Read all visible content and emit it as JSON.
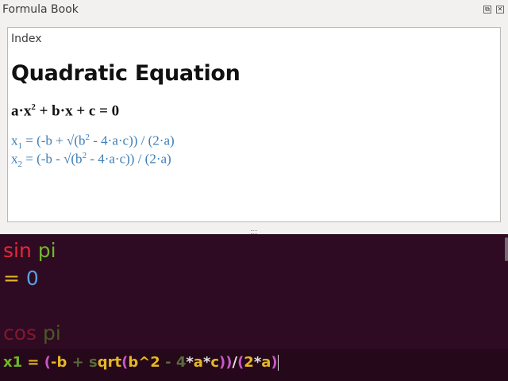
{
  "window": {
    "title": "Formula Book",
    "float_icon": "⧉",
    "close_icon": "✕"
  },
  "formula_panel": {
    "index_link": "Index",
    "heading": "Quadratic Equation",
    "equation": {
      "a": "a·x",
      "exp": "2",
      "rest": " + b·x + c = 0"
    },
    "solution1": {
      "x": "x",
      "sub": "1",
      "p1": " = (-b + √(b",
      "sup": "2",
      "p2": " - 4·a·c)) / (2·a)"
    },
    "solution2": {
      "x": "x",
      "sub": "2",
      "p1": " = (-b - √(b",
      "sup": "2",
      "p2": " - 4·a·c)) / (2·a)"
    }
  },
  "console": {
    "line1": {
      "fn": "sin",
      "arg": "pi"
    },
    "line2": {
      "eq": "=",
      "val": "0"
    },
    "line3": {
      "fn": "cos",
      "arg": "pi"
    },
    "input": {
      "t1": "x1",
      "t2": " = ",
      "t3": "(",
      "t4": "-b",
      "t5": " + ",
      "t6": "s",
      "t7": "qrt",
      "t8": "(",
      "t9": "b^2",
      "t10": " - ",
      "t11": "4",
      "t12": "*",
      "t13": "a",
      "t14": "*",
      "t15": "c",
      "t16": "))",
      "t17": "/",
      "t18": "(",
      "t19": "2",
      "t20": "*",
      "t21": "a",
      "t22": ")"
    }
  },
  "colors": {
    "console_bg": "#2e0b22",
    "link_blue": "#3d7eb8",
    "red": "#e6283a",
    "green": "#6fb62c",
    "yellow": "#e4b725",
    "blue": "#5a9fe0"
  }
}
